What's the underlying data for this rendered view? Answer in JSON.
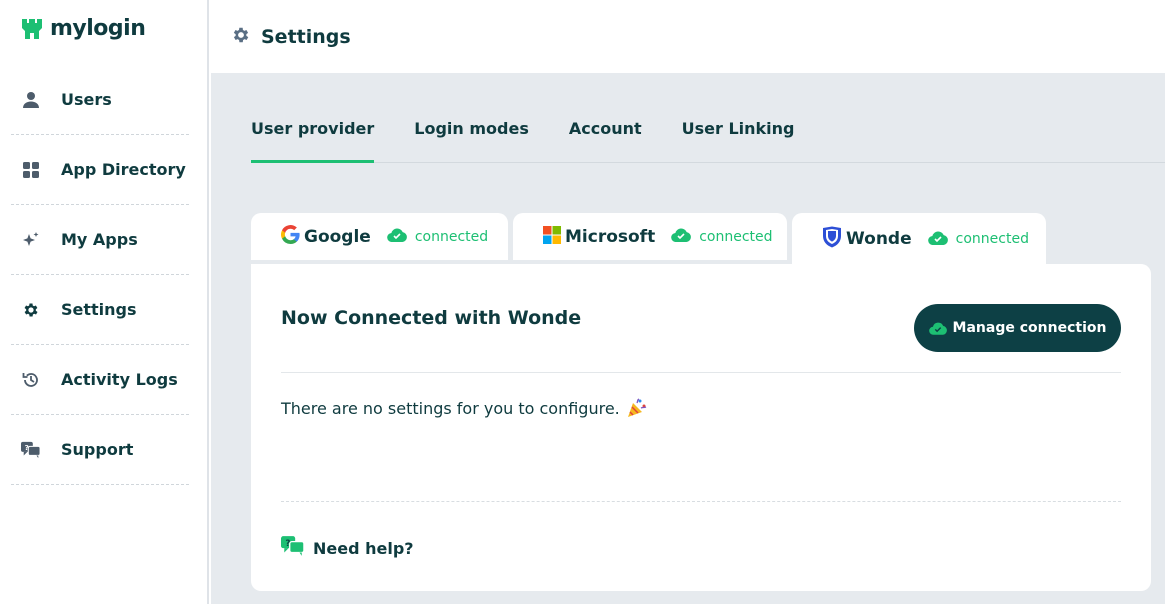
{
  "brand": {
    "name": "mylogin",
    "accent": "#1dbf73",
    "dark": "#0d4045"
  },
  "sidebar": {
    "items": [
      {
        "label": "Users",
        "icon": "user-icon"
      },
      {
        "label": "App Directory",
        "icon": "grid-icon"
      },
      {
        "label": "My Apps",
        "icon": "sparkle-icon"
      },
      {
        "label": "Settings",
        "icon": "gear-icon"
      },
      {
        "label": "Activity Logs",
        "icon": "history-icon"
      },
      {
        "label": "Support",
        "icon": "chat-question-icon"
      }
    ]
  },
  "header": {
    "title": "Settings",
    "icon": "gear-icon"
  },
  "tabs": [
    {
      "label": "User provider",
      "active": true
    },
    {
      "label": "Login modes",
      "active": false
    },
    {
      "label": "Account",
      "active": false
    },
    {
      "label": "User Linking",
      "active": false
    }
  ],
  "providers": [
    {
      "name": "Google",
      "status": "connected",
      "icon": "google-icon"
    },
    {
      "name": "Microsoft",
      "status": "connected",
      "icon": "microsoft-icon"
    },
    {
      "name": "Wonde",
      "status": "connected",
      "icon": "wonde-shield-icon",
      "active": true
    }
  ],
  "panel": {
    "title": "Now Connected with Wonde",
    "manage_label": "Manage connection",
    "message": "There are no settings for you to configure.",
    "help_label": "Need help?"
  }
}
